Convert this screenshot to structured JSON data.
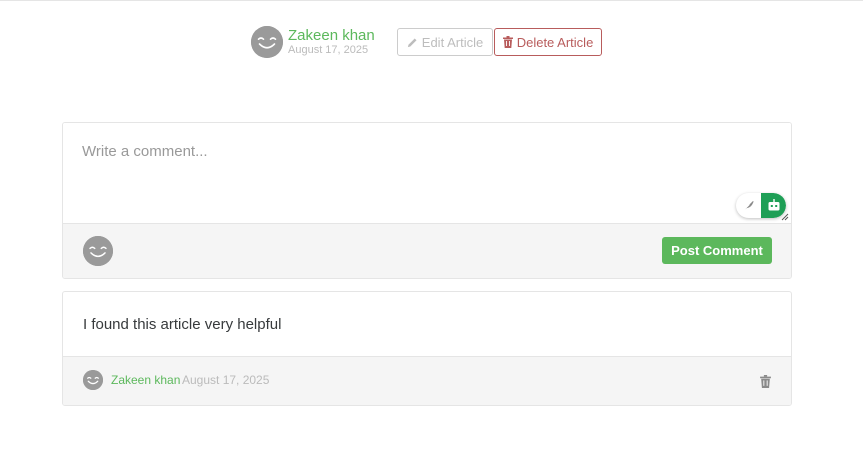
{
  "article": {
    "author": "Zakeen khan",
    "date": "August 17, 2025",
    "edit_label": "Edit Article",
    "delete_label": "Delete Article"
  },
  "comment_form": {
    "placeholder": "Write a comment...",
    "value": "",
    "post_label": "Post Comment"
  },
  "comments": [
    {
      "body": "I found this article very helpful",
      "author": "Zakeen khan",
      "date": "August 17, 2025"
    }
  ],
  "colors": {
    "brand_green": "#5cb85c",
    "danger": "#b85c5c",
    "muted": "#bbbbbb",
    "extension_green": "#1e9f56"
  },
  "icons": {
    "avatar": "smiley-avatar-icon",
    "edit": "pencil-icon",
    "delete": "trash-icon",
    "tools": [
      "feather-icon",
      "robot-icon"
    ]
  }
}
